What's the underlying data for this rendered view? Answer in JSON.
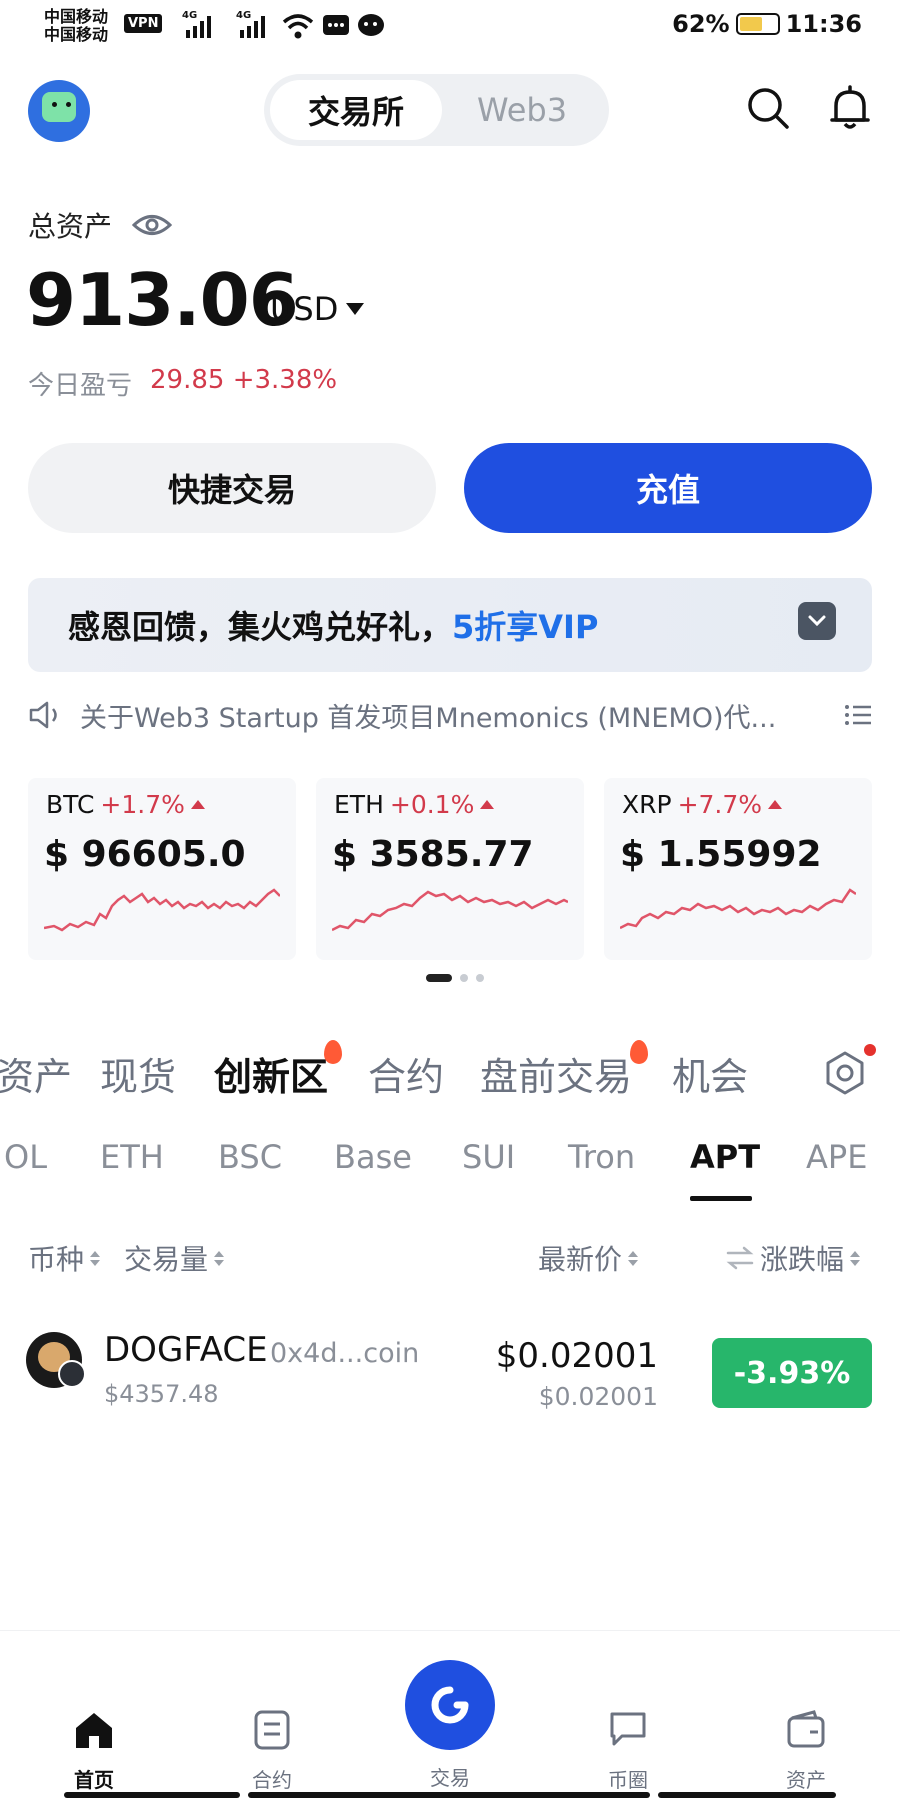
{
  "status_bar": {
    "carrier1": "中国移动",
    "carrier2": "中国移动",
    "vpn": "VPN",
    "net1": "4G",
    "net2": "4G",
    "battery_pct": "62%",
    "battery_level": 0.62,
    "time": "11:36"
  },
  "header": {
    "tab_exchange": "交易所",
    "tab_web3": "Web3",
    "active_tab": "交易所"
  },
  "assets": {
    "total_label": "总资产",
    "total_value": "913.06",
    "currency": "USD",
    "pnl_label": "今日盈亏",
    "pnl_value": "29.85 +3.38%"
  },
  "actions": {
    "quick_trade": "快捷交易",
    "deposit": "充值"
  },
  "banner": {
    "text": "感恩回馈，集火鸡兑好礼，",
    "highlight": "5折享VIP"
  },
  "notice": {
    "text": "关于Web3 Startup 首发项目Mnemonics (MNEMO)代..."
  },
  "tickers": [
    {
      "symbol": "BTC",
      "change": "+1.7%",
      "price": "$ 96605.0"
    },
    {
      "symbol": "ETH",
      "change": "+0.1%",
      "price": "$ 3585.77"
    },
    {
      "symbol": "XRP",
      "change": "+7.7%",
      "price": "$ 1.55992"
    }
  ],
  "categories": [
    "资产",
    "现货",
    "创新区",
    "合约",
    "盘前交易",
    "机会"
  ],
  "active_category": "创新区",
  "chains": [
    "OL",
    "ETH",
    "BSC",
    "Base",
    "SUI",
    "Tron",
    "APT",
    "APE"
  ],
  "active_chain": "APT",
  "columns": {
    "coin": "币种",
    "volume": "交易量",
    "price": "最新价",
    "change": "涨跌幅"
  },
  "rows": [
    {
      "name": "DOGFACE",
      "address": "0x4d...coin",
      "volume": "$4357.48",
      "price": "$0.02001",
      "price_sub": "$0.02001",
      "change": "-3.93%"
    }
  ],
  "nav": {
    "home": "首页",
    "futures": "合约",
    "trade": "交易",
    "community": "币圈",
    "assets": "资产"
  },
  "colors": {
    "brand_blue": "#1f4fe0",
    "up_red": "#d23a4b",
    "down_green": "#27b66b"
  }
}
